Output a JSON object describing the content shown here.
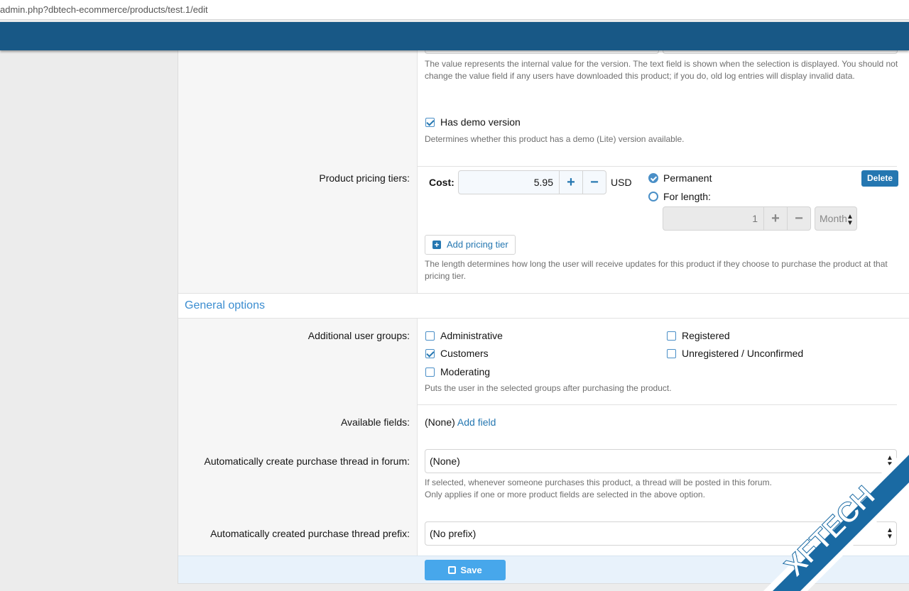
{
  "browser": {
    "url": "admin.php?dbtech-ecommerce/products/test.1/edit"
  },
  "version_field": {
    "hint": "The value represents the internal value for the version. The text field is shown when the selection is displayed. You should not change the value field if any users have downloaded this product; if you do, old log entries will display invalid data."
  },
  "demo": {
    "label": "Has demo version",
    "checked": true,
    "hint": "Determines whether this product has a demo (Lite) version available."
  },
  "pricing": {
    "row_label": "Product pricing tiers:",
    "cost_label": "Cost:",
    "cost_value": "5.95",
    "currency": "USD",
    "permanent_label": "Permanent",
    "for_length_label": "For length:",
    "length_value": "1",
    "length_unit": "Month",
    "delete_label": "Delete",
    "add_tier_label": "Add pricing tier",
    "hint": "The length determines how long the user will receive updates for this product if they choose to purchase the product at that pricing tier."
  },
  "general": {
    "heading": "General options",
    "user_groups_label": "Additional user groups:",
    "groups": [
      {
        "label": "Administrative",
        "checked": false
      },
      {
        "label": "Customers",
        "checked": true
      },
      {
        "label": "Moderating",
        "checked": false
      },
      {
        "label": "Registered",
        "checked": false
      },
      {
        "label": "Unregistered / Unconfirmed",
        "checked": false
      }
    ],
    "groups_hint": "Puts the user in the selected groups after purchasing the product.",
    "fields_label": "Available fields:",
    "fields_value": "(None)",
    "add_field_label": "Add field",
    "forum_label": "Automatically create purchase thread in forum:",
    "forum_value": "(None)",
    "forum_hint_1": "If selected, whenever someone purchases this product, a thread will be posted in this forum.",
    "forum_hint_2": "Only applies if one or more product fields are selected in the above option.",
    "prefix_label": "Automatically created purchase thread prefix:",
    "prefix_value": "(No prefix)"
  },
  "footer": {
    "save_label": "Save"
  },
  "watermark": {
    "text": "XFTECH"
  },
  "colors": {
    "header": "#185886",
    "accent": "#2577b1",
    "save": "#47a7eb",
    "watermark": "#1a6aa3"
  }
}
